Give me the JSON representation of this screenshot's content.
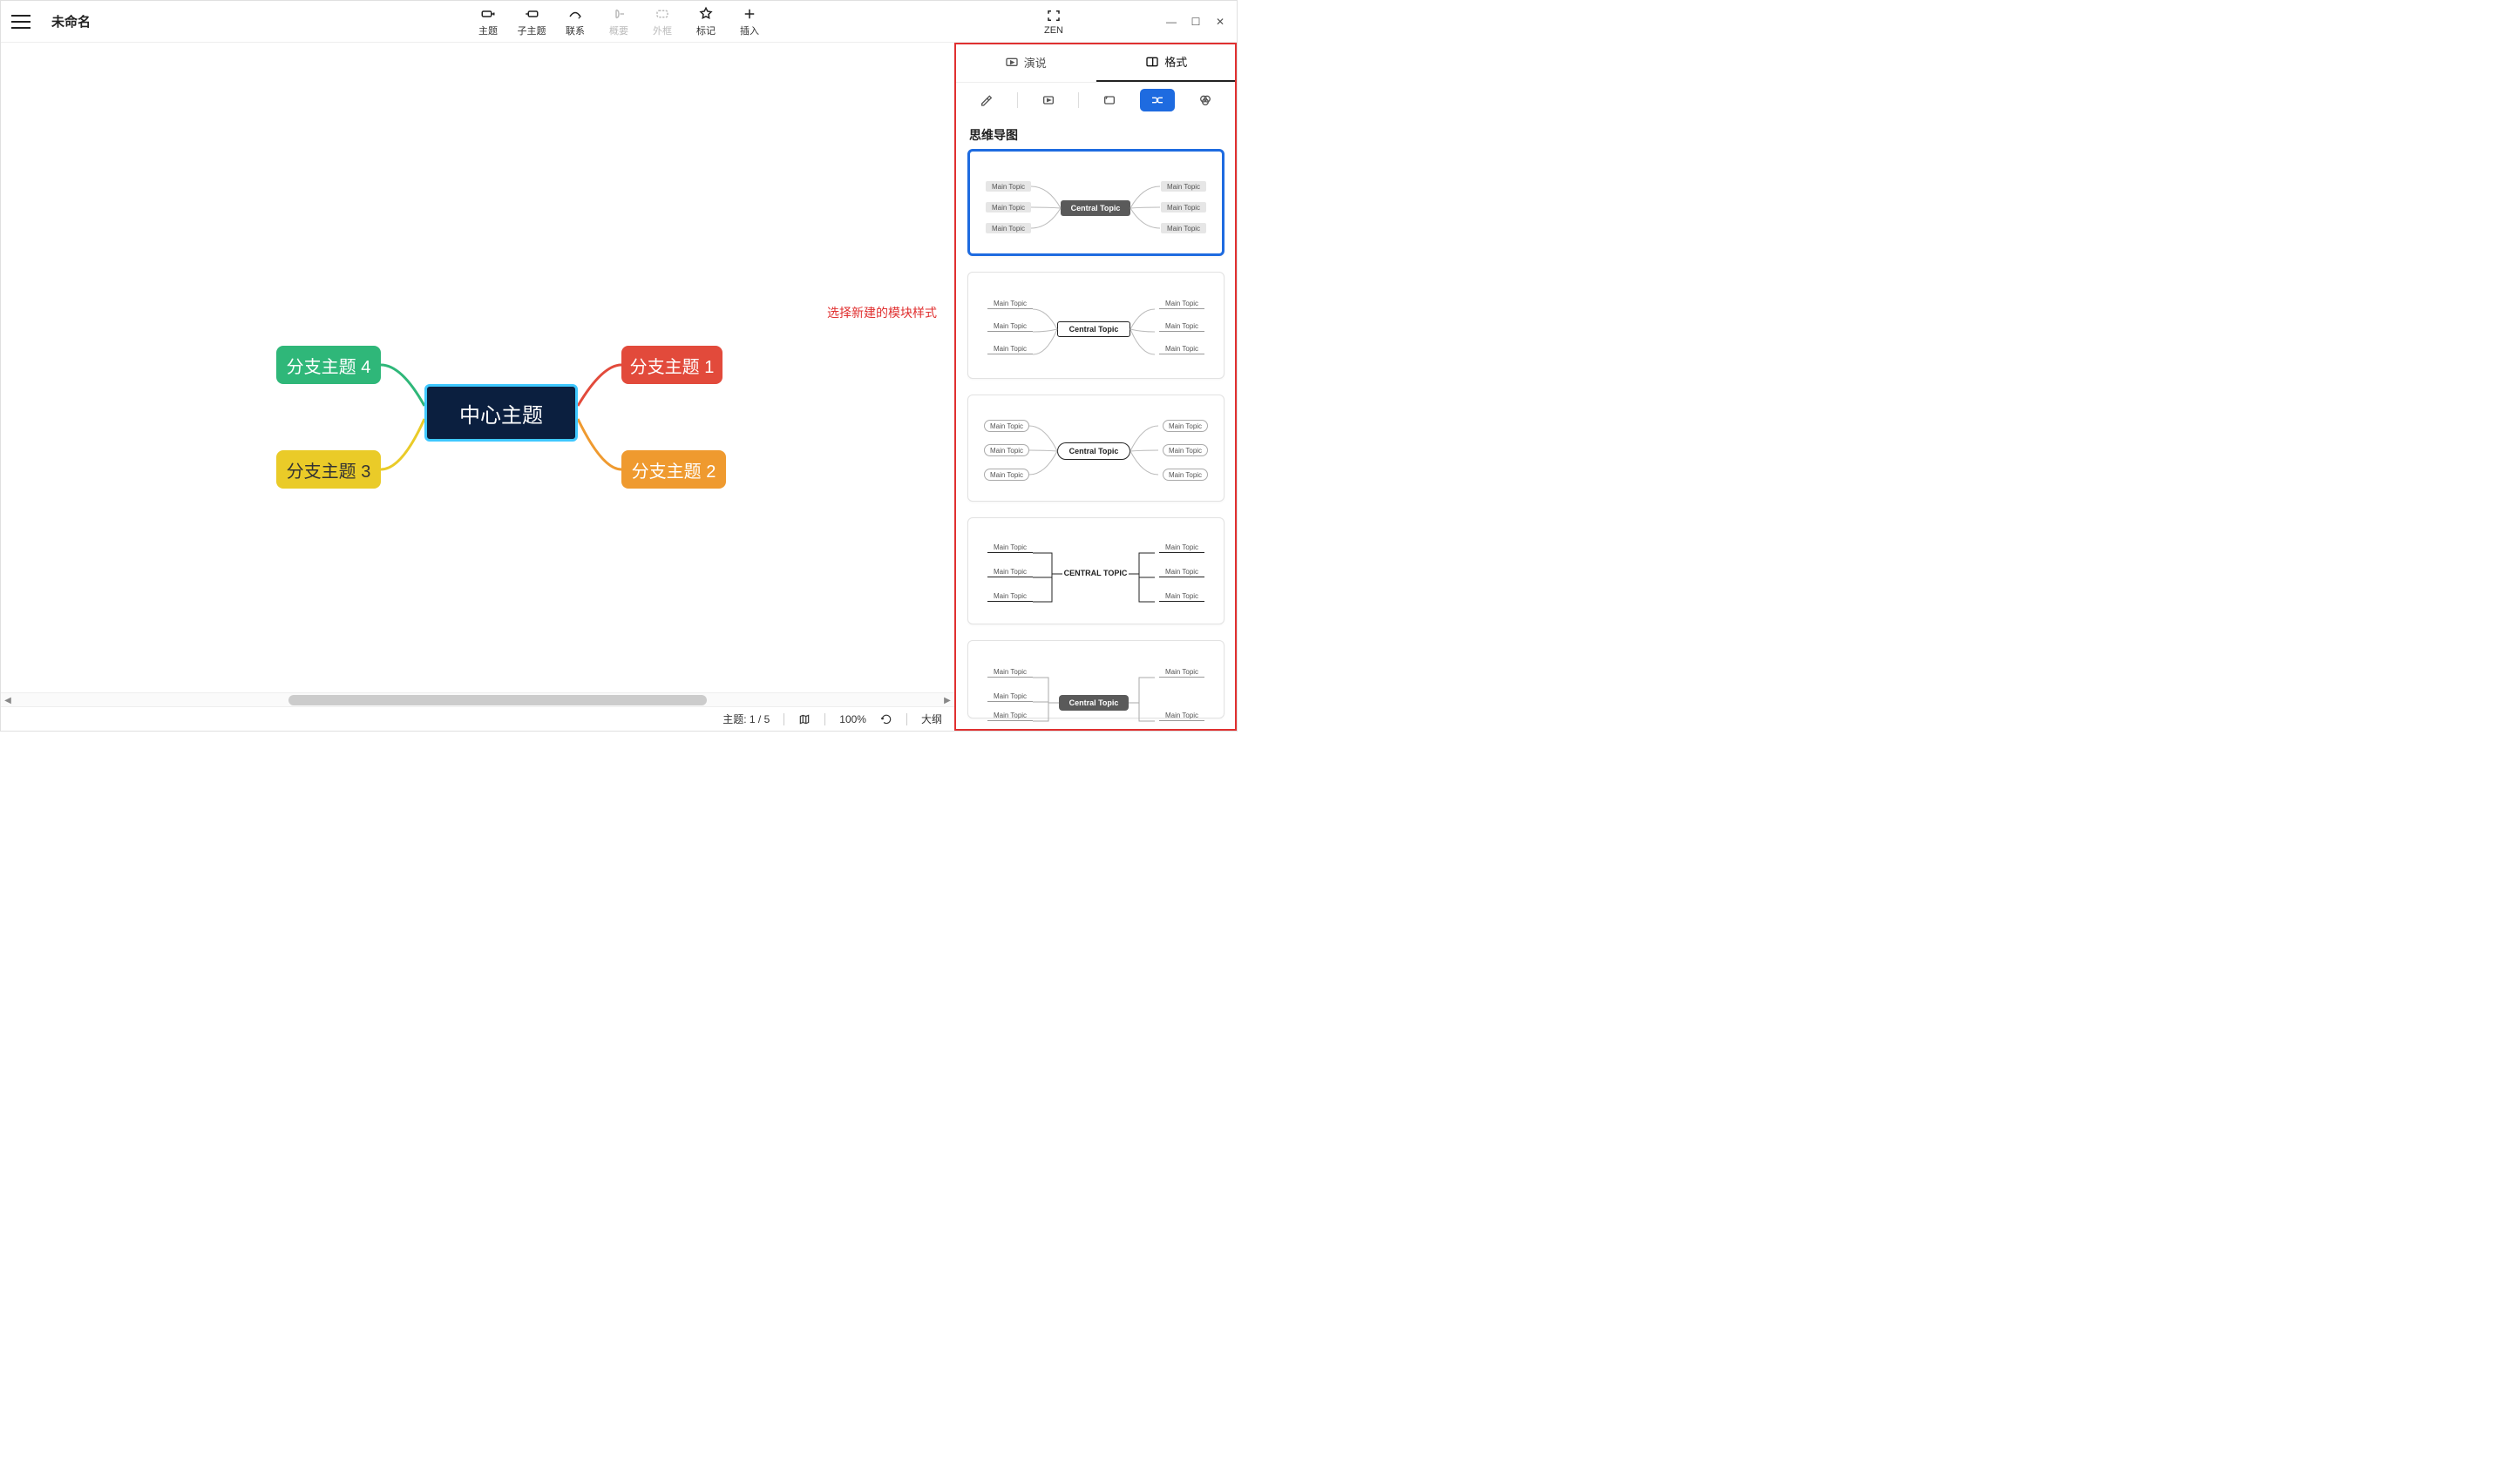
{
  "header": {
    "doc_title": "未命名",
    "tools": {
      "topic": "主题",
      "subtopic": "子主题",
      "relation": "联系",
      "summary": "概要",
      "boundary": "外框",
      "marker": "标记",
      "insert": "插入"
    },
    "right_tools": {
      "zen": "ZEN"
    }
  },
  "annotation": "选择新建的模块样式",
  "mindmap": {
    "center": "中心主题",
    "branches": {
      "b1": "分支主题 1",
      "b2": "分支主题 2",
      "b3": "分支主题 3",
      "b4": "分支主题 4"
    },
    "colors": {
      "center_bg": "#0b1f3f",
      "center_border": "#3fc8ff",
      "b1": "#e24a3b",
      "b2": "#ef9a2f",
      "b3": "#eacb28",
      "b4": "#2fb779"
    }
  },
  "panel": {
    "tabs": {
      "present": "演说",
      "format": "格式"
    },
    "heading": "思维导图",
    "thumb_labels": {
      "main": "Main Topic",
      "central1": "Central Topic",
      "central2": "CENTRAL TOPIC"
    }
  },
  "statusbar": {
    "topic_count": "主题: 1 / 5",
    "zoom": "100%",
    "outline": "大纲"
  }
}
